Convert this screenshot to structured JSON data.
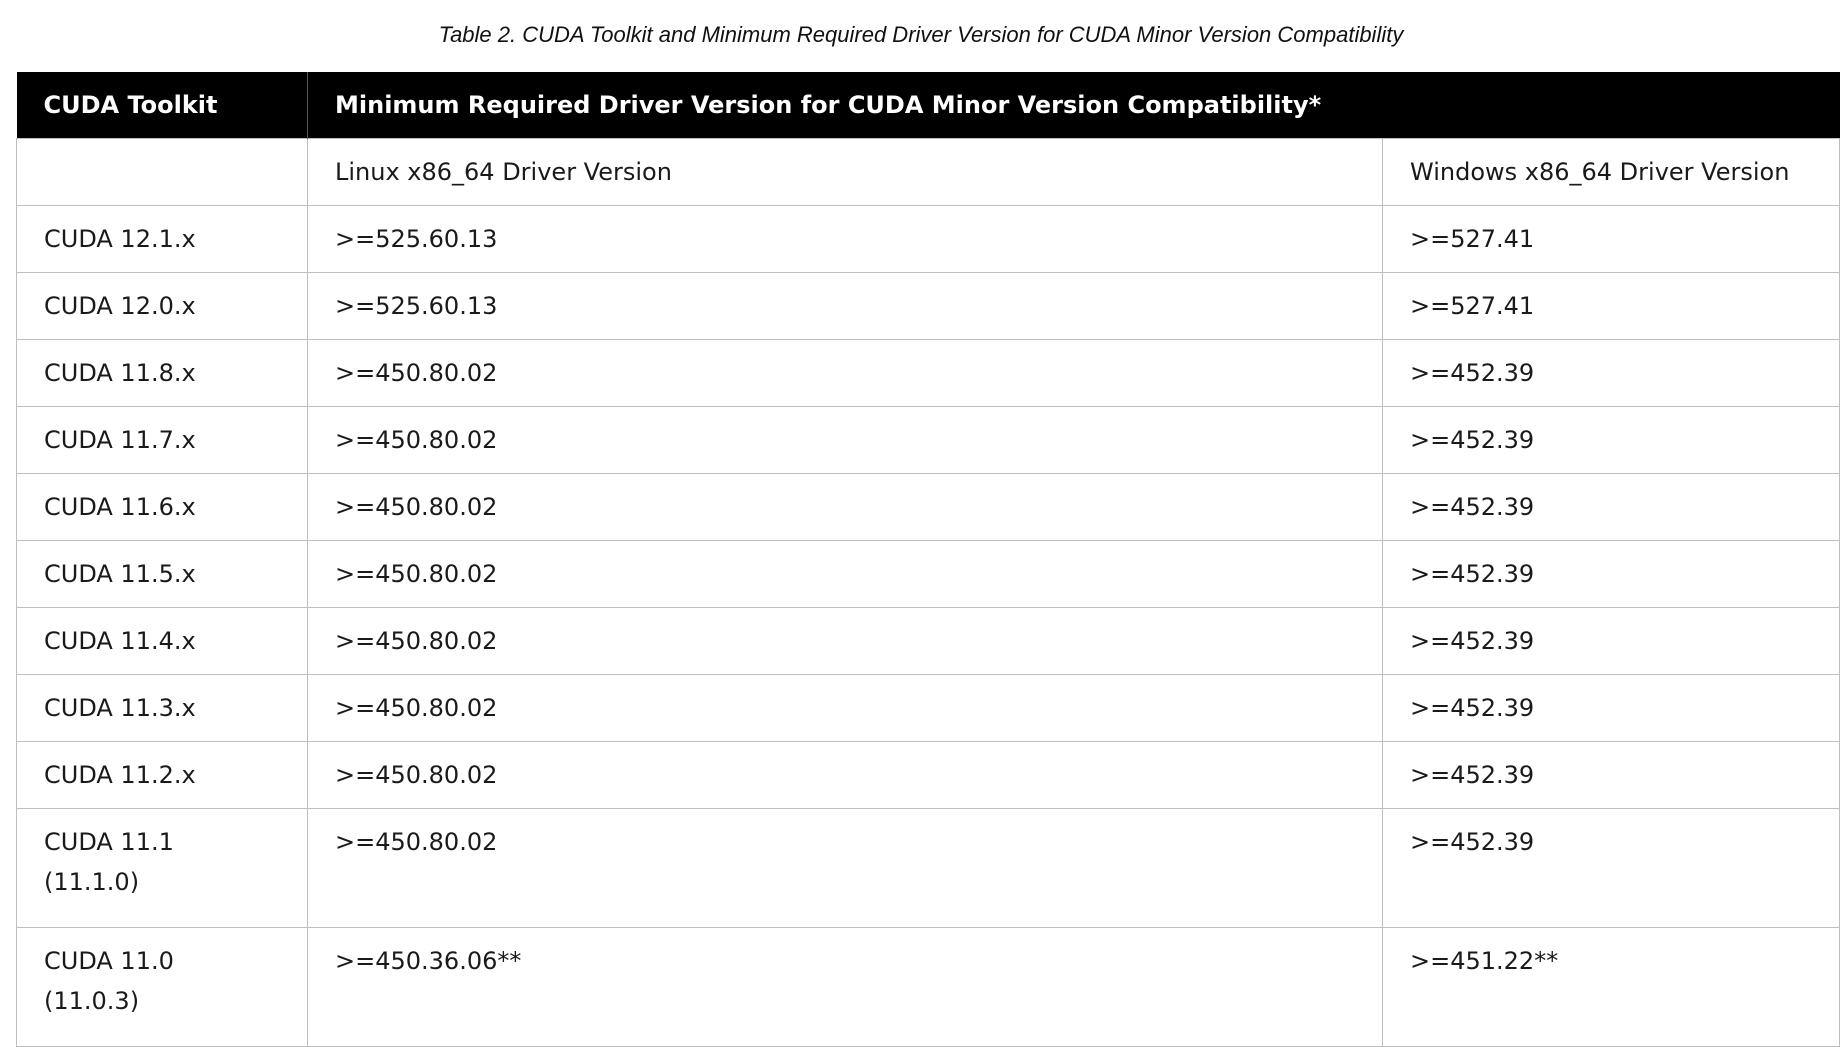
{
  "caption": "Table 2. CUDA Toolkit and Minimum Required Driver Version for CUDA Minor Version Compatibility",
  "table": {
    "headers": {
      "toolkit": "CUDA Toolkit",
      "min_driver": "Minimum Required Driver Version for CUDA Minor Version Compatibility*"
    },
    "subheaders": {
      "blank": "",
      "linux": "Linux x86_64 Driver Version",
      "windows": "Windows x86_64 Driver Version"
    },
    "rows": [
      {
        "toolkit": "CUDA 12.1.x",
        "toolkit_sub": "",
        "linux": ">=525.60.13",
        "windows": ">=527.41"
      },
      {
        "toolkit": "CUDA 12.0.x",
        "toolkit_sub": "",
        "linux": ">=525.60.13",
        "windows": ">=527.41"
      },
      {
        "toolkit": "CUDA 11.8.x",
        "toolkit_sub": "",
        "linux": ">=450.80.02",
        "windows": ">=452.39"
      },
      {
        "toolkit": "CUDA 11.7.x",
        "toolkit_sub": "",
        "linux": ">=450.80.02",
        "windows": ">=452.39"
      },
      {
        "toolkit": "CUDA 11.6.x",
        "toolkit_sub": "",
        "linux": ">=450.80.02",
        "windows": ">=452.39"
      },
      {
        "toolkit": "CUDA 11.5.x",
        "toolkit_sub": "",
        "linux": ">=450.80.02",
        "windows": ">=452.39"
      },
      {
        "toolkit": "CUDA 11.4.x",
        "toolkit_sub": "",
        "linux": ">=450.80.02",
        "windows": ">=452.39"
      },
      {
        "toolkit": "CUDA 11.3.x",
        "toolkit_sub": "",
        "linux": ">=450.80.02",
        "windows": ">=452.39"
      },
      {
        "toolkit": "CUDA 11.2.x",
        "toolkit_sub": "",
        "linux": ">=450.80.02",
        "windows": ">=452.39"
      },
      {
        "toolkit": "CUDA 11.1",
        "toolkit_sub": "(11.1.0)",
        "linux": ">=450.80.02",
        "windows": ">=452.39"
      },
      {
        "toolkit": "CUDA 11.0",
        "toolkit_sub": "(11.0.3)",
        "linux": ">=450.36.06**",
        "windows": ">=451.22**"
      }
    ]
  }
}
